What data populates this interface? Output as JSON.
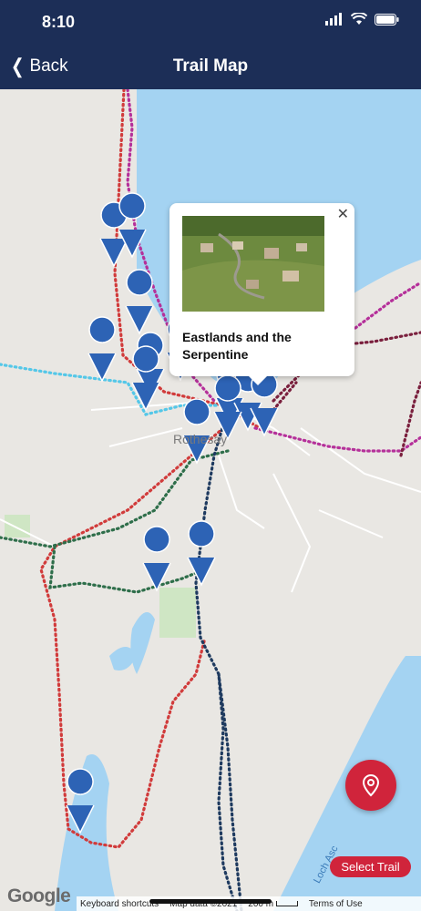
{
  "status_bar": {
    "time": "8:10"
  },
  "header": {
    "back_label": "Back",
    "title": "Trail Map"
  },
  "map": {
    "town_label": "Rothesay",
    "loch_label": "Loch Asc",
    "popup": {
      "title": "Eastlands and the Serpentine",
      "close_icon": "close-icon"
    },
    "trail_colors": {
      "red": "#d13b3b",
      "green": "#2e6e4a",
      "navy": "#1e3a5f",
      "magenta": "#b5309a",
      "maroon": "#7a1f3d",
      "cyan": "#54c7e8"
    },
    "marker_color": "#2d63b5",
    "water_color": "#a4d3f2"
  },
  "actions": {
    "locate_icon": "location-pin-icon",
    "select_trail_label": "Select Trail"
  },
  "attribution": {
    "google": "Google",
    "keyboard": "Keyboard shortcuts",
    "map_data": "Map data ©2021",
    "scale": "200 m",
    "terms": "Terms of Use"
  }
}
